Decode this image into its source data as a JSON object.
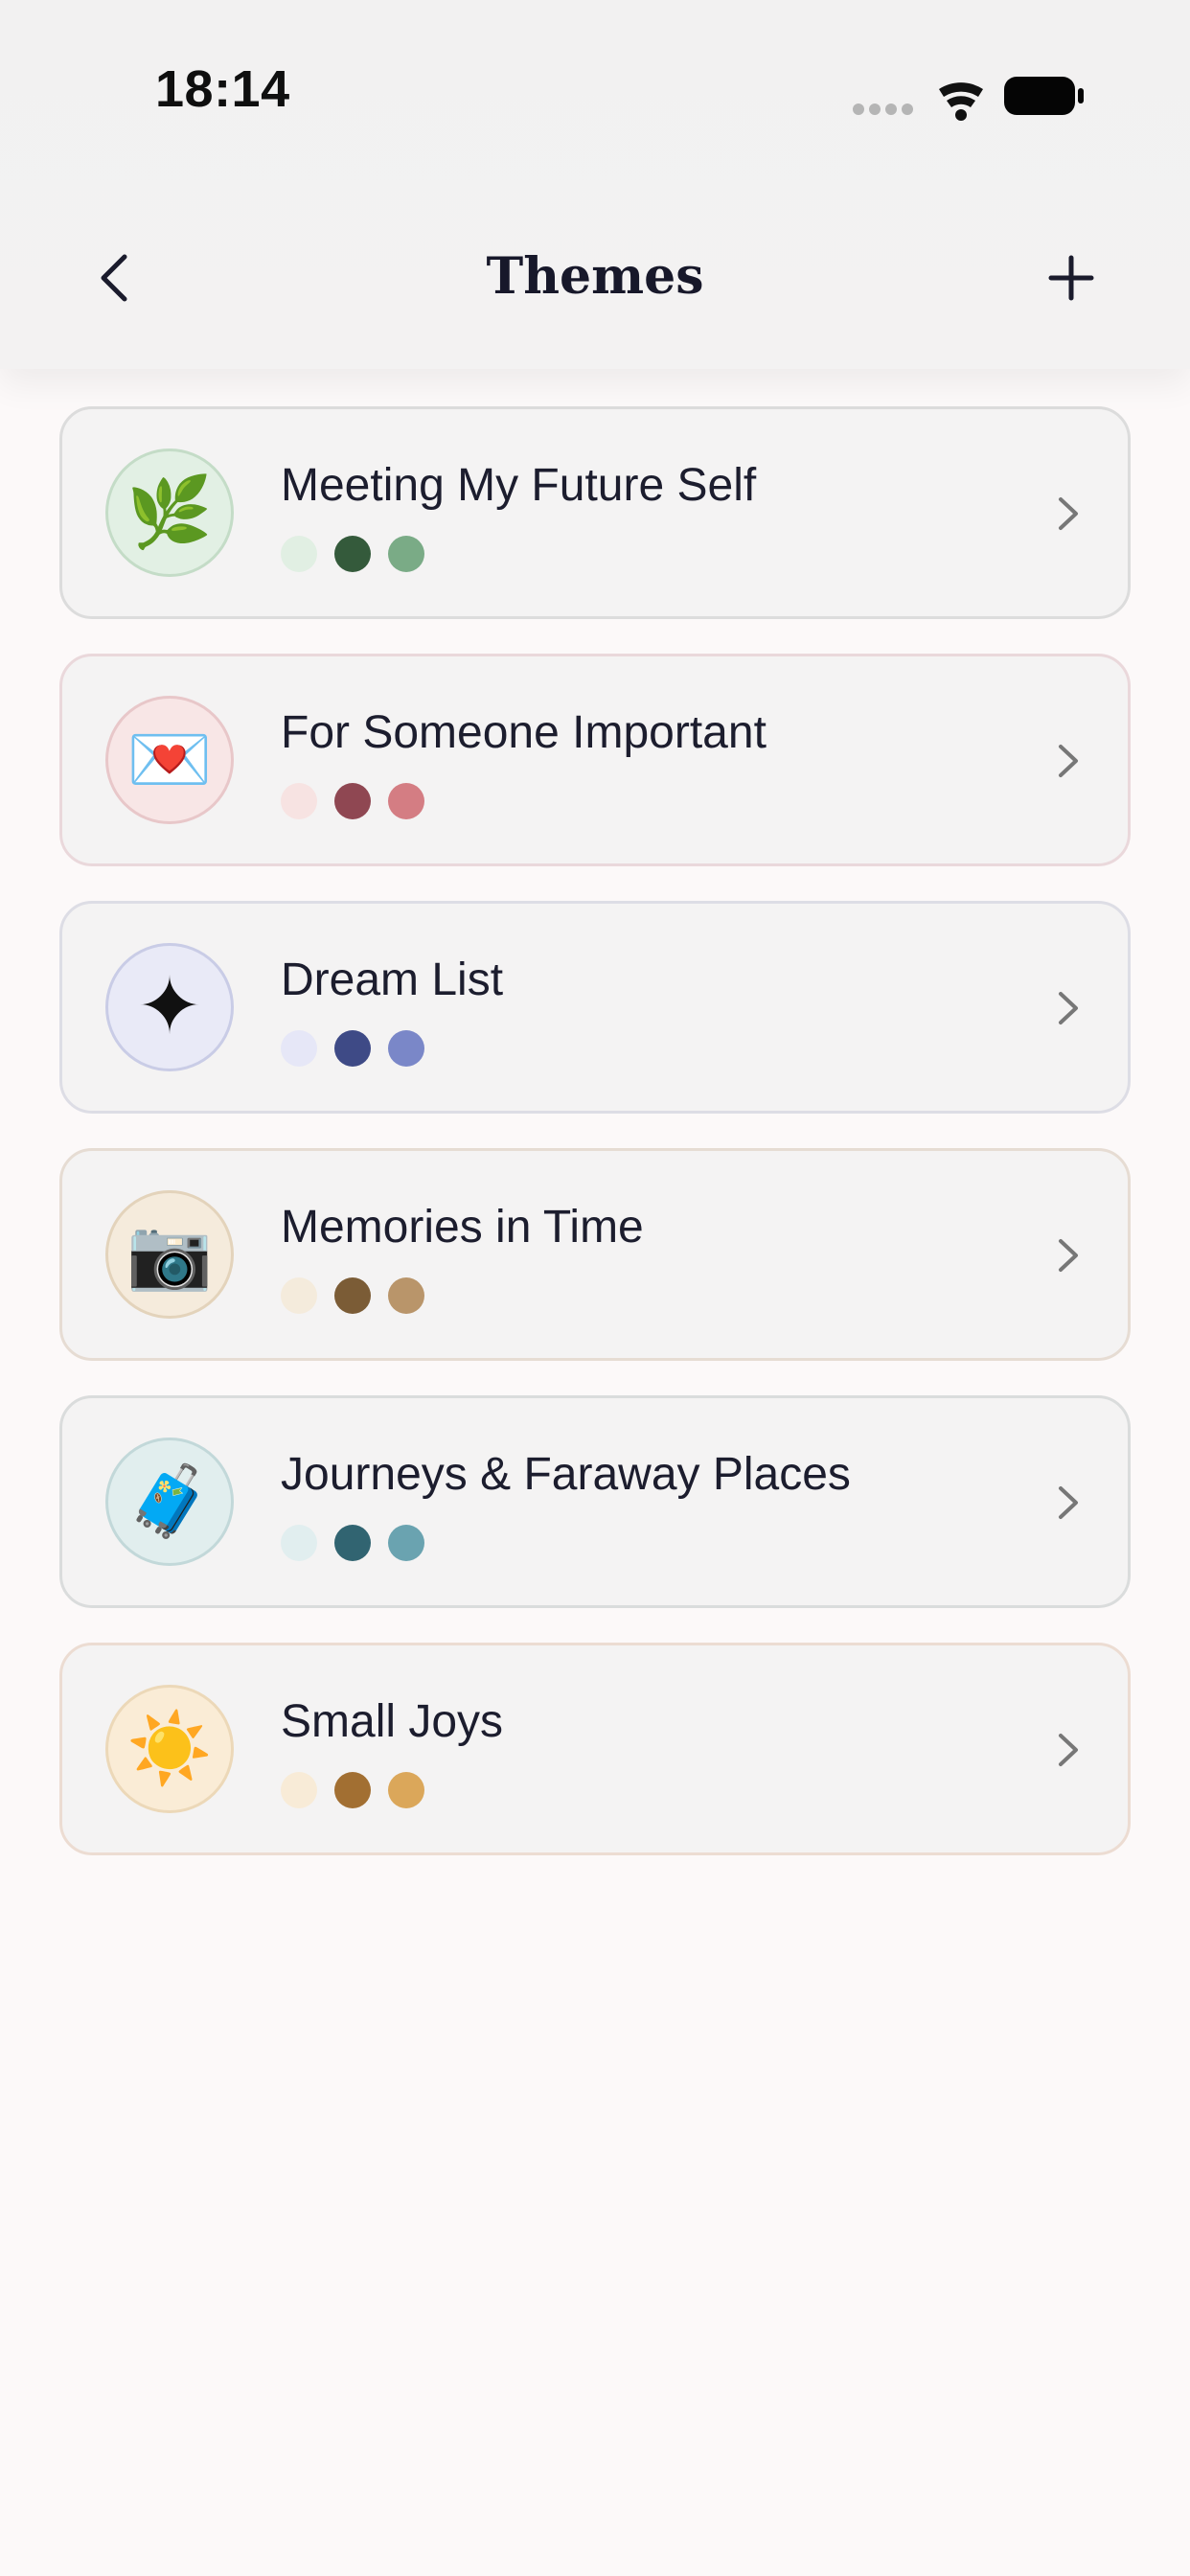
{
  "status_bar": {
    "time": "18:14"
  },
  "nav": {
    "title": "Themes",
    "back_icon": "chevron-left-icon",
    "add_icon": "plus-icon"
  },
  "themes": [
    {
      "title": "Meeting My Future Self",
      "icon": "herb-emoji",
      "glyph": "🌿",
      "icon_bg": "#e2f0e4",
      "icon_border": "#c4dcc7",
      "card_border": "#dcdcdc",
      "swatches": [
        "#e1efe3",
        "#345a3b",
        "#7aab86"
      ]
    },
    {
      "title": "For Someone Important",
      "icon": "love-letter-emoji",
      "glyph": "💌",
      "icon_bg": "#f8e6e6",
      "icon_border": "#e8c7c9",
      "card_border": "#ead8db",
      "swatches": [
        "#f7e3e2",
        "#8f4752",
        "#d47d83"
      ]
    },
    {
      "title": "Dream List",
      "icon": "sparkle-icon",
      "glyph": "✦",
      "icon_bg": "#e9eaf7",
      "icon_border": "#c9cce6",
      "card_border": "#dddde5",
      "swatches": [
        "#e6e7f7",
        "#3e4a86",
        "#7a87c8"
      ]
    },
    {
      "title": "Memories in Time",
      "icon": "camera-emoji",
      "glyph": "📷",
      "icon_bg": "#f5ebdc",
      "icon_border": "#e3d3bb",
      "card_border": "#e6dcd3",
      "swatches": [
        "#f4ebdc",
        "#7b5c36",
        "#b9956a"
      ]
    },
    {
      "title": "Journeys & Faraway Places",
      "icon": "luggage-emoji",
      "glyph": "🧳",
      "icon_bg": "#e1eeee",
      "icon_border": "#c2d8d9",
      "card_border": "#dadcdc",
      "swatches": [
        "#e1eeef",
        "#316471",
        "#6aa3b0"
      ]
    },
    {
      "title": "Small Joys",
      "icon": "sun-emoji",
      "glyph": "☀️",
      "icon_bg": "#faecd6",
      "icon_border": "#ecd8b8",
      "card_border": "#ecdcd2",
      "swatches": [
        "#f8ebd7",
        "#a26f32",
        "#dba75a"
      ]
    }
  ]
}
